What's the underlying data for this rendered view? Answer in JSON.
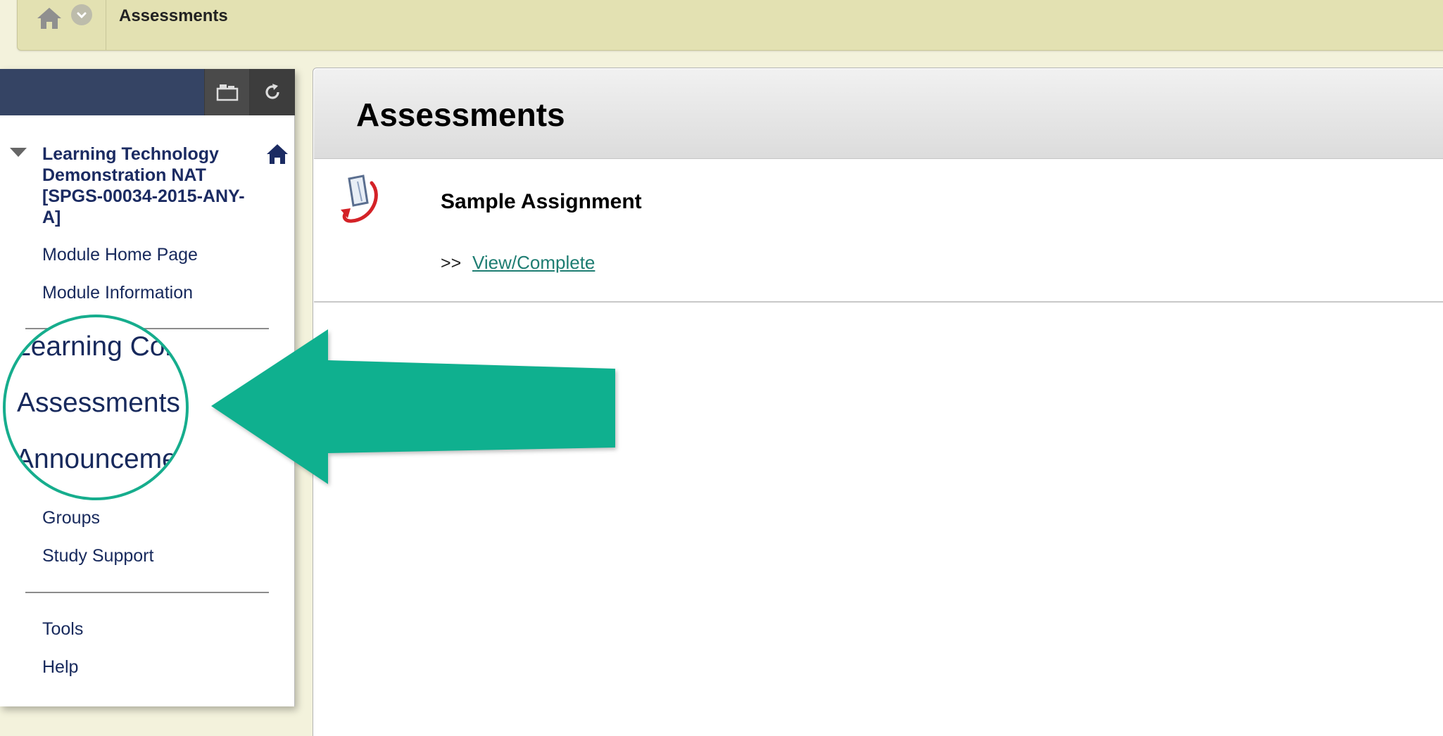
{
  "breadcrumb": {
    "current": "Assessments",
    "icons": [
      "home-icon",
      "chevron-down-icon"
    ]
  },
  "sidebar": {
    "header_buttons": [
      "folder-icon",
      "refresh-icon"
    ],
    "course_title": "Learning Technology Demonstration NAT [SPGS-00034-2015-ANY-A]",
    "items": [
      {
        "label": "Module Home Page"
      },
      {
        "label": "Module Information"
      },
      {
        "label": "Groups"
      },
      {
        "label": "Study Support"
      },
      {
        "label": "Tools"
      },
      {
        "label": "Help"
      }
    ]
  },
  "magnifier": {
    "lines": [
      "Learning Con",
      "Assessments",
      "Announceme"
    ]
  },
  "content": {
    "title": "Assessments",
    "items": [
      {
        "title": "Sample Assignment",
        "link_prefix": ">>",
        "link_label": "View/Complete"
      }
    ]
  },
  "colors": {
    "breadcrumb_bg": "#e3e1b2",
    "sidebar_header": "#354464",
    "nav_text": "#17295c",
    "accent_callout": "#0fb08f",
    "link": "#1e7d72"
  }
}
